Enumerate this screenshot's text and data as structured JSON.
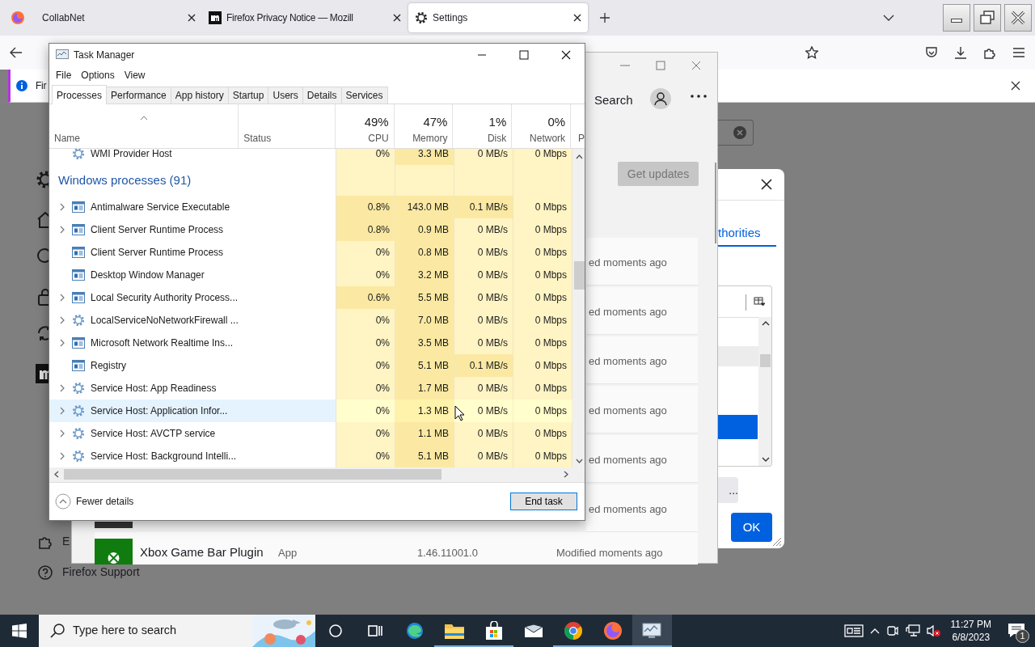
{
  "browser": {
    "tabs": [
      {
        "title": "CollabNet",
        "kind": "plain",
        "selected": false
      },
      {
        "title": "Firefox Privacy Notice — Mozill",
        "kind": "mozilla",
        "selected": false
      },
      {
        "title": "Settings",
        "kind": "gear",
        "selected": true
      }
    ],
    "notice": {
      "text": "Fir"
    },
    "sidebar": [
      {
        "kind": "gear"
      },
      {
        "kind": "home"
      },
      {
        "kind": "search"
      },
      {
        "kind": "lock"
      },
      {
        "kind": "sync"
      },
      {
        "kind": "logo"
      }
    ],
    "sidebar_footer": [
      {
        "kind": "puzzle",
        "label": "E"
      },
      {
        "kind": "help",
        "label": "Firefox Support"
      }
    ]
  },
  "store_window": {
    "search_label": "Search",
    "get_updates": "Get updates",
    "rows": [
      {
        "status": "ed moments ago"
      },
      {
        "status": "ed moments ago"
      },
      {
        "status": "ed moments ago"
      },
      {
        "status": "ed moments ago"
      },
      {
        "status": "ed moments ago"
      },
      {
        "status": "ed moments ago"
      }
    ],
    "last_row": {
      "name": "Xbox Game Bar Plugin",
      "type": "App",
      "version": "1.46.11001.0",
      "status": "Modified moments ago"
    }
  },
  "dialog": {
    "tab": "thorities",
    "more_button": "...",
    "ok_button": "OK"
  },
  "task_manager": {
    "title": "Task Manager",
    "menu": [
      "File",
      "Options",
      "View"
    ],
    "tabs": [
      {
        "label": "Processes",
        "selected": true
      },
      {
        "label": "Performance",
        "selected": false
      },
      {
        "label": "App history",
        "selected": false
      },
      {
        "label": "Startup",
        "selected": false
      },
      {
        "label": "Users",
        "selected": false
      },
      {
        "label": "Details",
        "selected": false
      },
      {
        "label": "Services",
        "selected": false
      }
    ],
    "columns": [
      {
        "label": "Name",
        "sorted": true
      },
      {
        "label": "Status",
        "sorted": false
      },
      {
        "label": "CPU",
        "percent": "49%",
        "sorted": false
      },
      {
        "label": "Memory",
        "percent": "47%",
        "sorted": false
      },
      {
        "label": "Disk",
        "percent": "1%",
        "sorted": false
      },
      {
        "label": "Network",
        "percent": "0%",
        "sorted": false
      },
      {
        "label": "P",
        "sorted": false
      }
    ],
    "rows": [
      {
        "kind": "service",
        "name": "WMI Provider Host",
        "expandable": false,
        "selected": false,
        "cells": [
          {
            "text": "0%",
            "busy": false
          },
          {
            "text": "3.3 MB",
            "busy": true
          },
          {
            "text": "0 MB/s",
            "busy": false
          },
          {
            "text": "0 Mbps",
            "busy": false
          }
        ]
      },
      {
        "kind": "group",
        "name": "Windows processes (91)"
      },
      {
        "kind": "window",
        "name": "Antimalware Service Executable",
        "expandable": true,
        "selected": false,
        "cells": [
          {
            "text": "0.8%",
            "busy": true
          },
          {
            "text": "143.0 MB",
            "busy": true
          },
          {
            "text": "0.1 MB/s",
            "busy": true
          },
          {
            "text": "0 Mbps",
            "busy": false
          }
        ]
      },
      {
        "kind": "window",
        "name": "Client Server Runtime Process",
        "expandable": true,
        "selected": false,
        "cells": [
          {
            "text": "0.8%",
            "busy": true
          },
          {
            "text": "0.9 MB",
            "busy": true
          },
          {
            "text": "0 MB/s",
            "busy": false
          },
          {
            "text": "0 Mbps",
            "busy": false
          }
        ]
      },
      {
        "kind": "window",
        "name": "Client Server Runtime Process",
        "expandable": false,
        "selected": false,
        "cells": [
          {
            "text": "0%",
            "busy": false
          },
          {
            "text": "0.8 MB",
            "busy": true
          },
          {
            "text": "0 MB/s",
            "busy": false
          },
          {
            "text": "0 Mbps",
            "busy": false
          }
        ]
      },
      {
        "kind": "window",
        "name": "Desktop Window Manager",
        "expandable": false,
        "selected": false,
        "cells": [
          {
            "text": "0%",
            "busy": false
          },
          {
            "text": "3.2 MB",
            "busy": true
          },
          {
            "text": "0 MB/s",
            "busy": false
          },
          {
            "text": "0 Mbps",
            "busy": false
          }
        ]
      },
      {
        "kind": "window",
        "name": "Local Security Authority Process...",
        "expandable": true,
        "selected": false,
        "cells": [
          {
            "text": "0.6%",
            "busy": true
          },
          {
            "text": "5.5 MB",
            "busy": true
          },
          {
            "text": "0 MB/s",
            "busy": false
          },
          {
            "text": "0 Mbps",
            "busy": false
          }
        ]
      },
      {
        "kind": "service",
        "name": "LocalServiceNoNetworkFirewall ...",
        "expandable": true,
        "selected": false,
        "cells": [
          {
            "text": "0%",
            "busy": false
          },
          {
            "text": "7.0 MB",
            "busy": true
          },
          {
            "text": "0 MB/s",
            "busy": false
          },
          {
            "text": "0 Mbps",
            "busy": false
          }
        ]
      },
      {
        "kind": "window",
        "name": "Microsoft Network Realtime Ins...",
        "expandable": true,
        "selected": false,
        "cells": [
          {
            "text": "0%",
            "busy": false
          },
          {
            "text": "3.5 MB",
            "busy": true
          },
          {
            "text": "0 MB/s",
            "busy": false
          },
          {
            "text": "0 Mbps",
            "busy": false
          }
        ]
      },
      {
        "kind": "window",
        "name": "Registry",
        "expandable": false,
        "selected": false,
        "cells": [
          {
            "text": "0%",
            "busy": false
          },
          {
            "text": "5.1 MB",
            "busy": true
          },
          {
            "text": "0.1 MB/s",
            "busy": true
          },
          {
            "text": "0 Mbps",
            "busy": false
          }
        ]
      },
      {
        "kind": "service",
        "name": "Service Host: App Readiness",
        "expandable": true,
        "selected": false,
        "cells": [
          {
            "text": "0%",
            "busy": false
          },
          {
            "text": "1.7 MB",
            "busy": true
          },
          {
            "text": "0 MB/s",
            "busy": false
          },
          {
            "text": "0 Mbps",
            "busy": false
          }
        ]
      },
      {
        "kind": "service",
        "name": "Service Host: Application Infor...",
        "expandable": true,
        "selected": true,
        "cells": [
          {
            "text": "0%",
            "busy": false
          },
          {
            "text": "1.3 MB",
            "busy": true
          },
          {
            "text": "0 MB/s",
            "busy": false
          },
          {
            "text": "0 Mbps",
            "busy": false
          }
        ]
      },
      {
        "kind": "service",
        "name": "Service Host: AVCTP service",
        "expandable": true,
        "selected": false,
        "cells": [
          {
            "text": "0%",
            "busy": false
          },
          {
            "text": "1.1 MB",
            "busy": true
          },
          {
            "text": "0 MB/s",
            "busy": false
          },
          {
            "text": "0 Mbps",
            "busy": false
          }
        ]
      },
      {
        "kind": "service",
        "name": "Service Host: Background Intelli...",
        "expandable": true,
        "selected": false,
        "cells": [
          {
            "text": "0%",
            "busy": false
          },
          {
            "text": "5.1 MB",
            "busy": true
          },
          {
            "text": "0 MB/s",
            "busy": false
          },
          {
            "text": "0 Mbps",
            "busy": false
          }
        ]
      }
    ],
    "fewer_details": "Fewer details",
    "end_task": "End task"
  },
  "taskbar": {
    "search_placeholder": "Type here to search",
    "apps": [
      {
        "kind": "cortana",
        "running": false,
        "active": false
      },
      {
        "kind": "taskview",
        "running": false,
        "active": false
      },
      {
        "kind": "edge",
        "running": false,
        "active": false
      },
      {
        "kind": "explorer",
        "running": true,
        "active": false
      },
      {
        "kind": "store",
        "running": true,
        "active": false
      },
      {
        "kind": "mail",
        "running": false,
        "active": false
      },
      {
        "kind": "chrome",
        "running": true,
        "active": false
      },
      {
        "kind": "firefox",
        "running": true,
        "active": false
      },
      {
        "kind": "taskmanager",
        "running": true,
        "active": true
      }
    ],
    "tray": [
      {
        "kind": "news"
      },
      {
        "kind": "chevron"
      },
      {
        "kind": "camera"
      },
      {
        "kind": "network"
      },
      {
        "kind": "volume-muted"
      }
    ],
    "time": "11:27 PM",
    "date": "6/8/2023",
    "notifications": "1"
  }
}
